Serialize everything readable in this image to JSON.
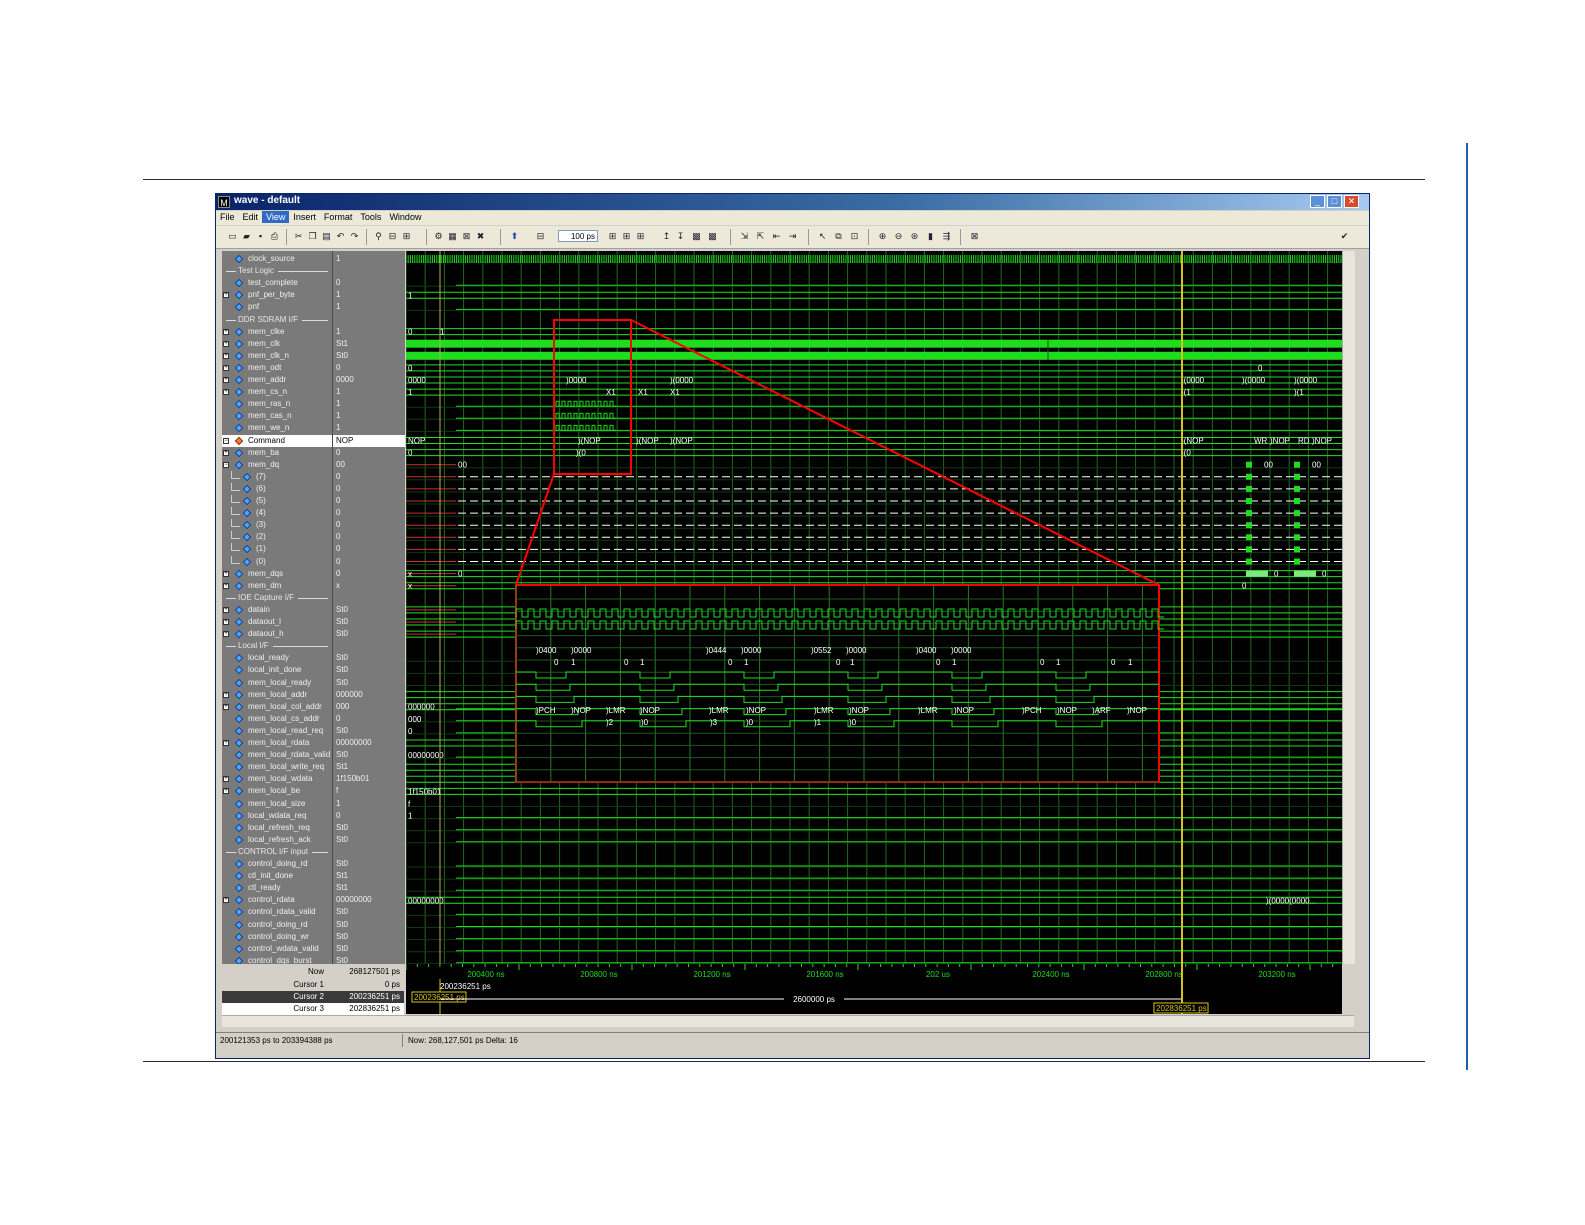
{
  "window": {
    "title": "wave - default",
    "menus": [
      "File",
      "Edit",
      "View",
      "Insert",
      "Format",
      "Tools",
      "Window"
    ],
    "active_menu": "View",
    "zoom_field": "100 ps"
  },
  "signals": [
    {
      "name": "clock_source",
      "value": "1",
      "type": "sig"
    },
    {
      "name": "Test Logic",
      "type": "divider"
    },
    {
      "name": "test_complete",
      "value": "0",
      "type": "sig"
    },
    {
      "name": "pnf_per_byte",
      "value": "1",
      "type": "bus"
    },
    {
      "name": "pnf",
      "value": "1",
      "type": "sig"
    },
    {
      "name": "DDR SDRAM I/F",
      "type": "divider"
    },
    {
      "name": "mem_clke",
      "value": "1",
      "type": "bus"
    },
    {
      "name": "mem_clk",
      "value": "St1",
      "type": "bus"
    },
    {
      "name": "mem_clk_n",
      "value": "St0",
      "type": "bus"
    },
    {
      "name": "mem_odt",
      "value": "0",
      "type": "bus"
    },
    {
      "name": "mem_addr",
      "value": "0000",
      "type": "bus"
    },
    {
      "name": "mem_cs_n",
      "value": "1",
      "type": "bus"
    },
    {
      "name": "mem_ras_n",
      "value": "1",
      "type": "sig"
    },
    {
      "name": "mem_cas_n",
      "value": "1",
      "type": "sig"
    },
    {
      "name": "mem_we_n",
      "value": "1",
      "type": "sig"
    },
    {
      "name": "Command",
      "value": "NOP",
      "type": "cmd"
    },
    {
      "name": "mem_ba",
      "value": "0",
      "type": "bus"
    },
    {
      "name": "mem_dq",
      "value": "00",
      "type": "busopen"
    },
    {
      "name": "(7)",
      "value": "0",
      "type": "child"
    },
    {
      "name": "(6)",
      "value": "0",
      "type": "child"
    },
    {
      "name": "(5)",
      "value": "0",
      "type": "child"
    },
    {
      "name": "(4)",
      "value": "0",
      "type": "child"
    },
    {
      "name": "(3)",
      "value": "0",
      "type": "child"
    },
    {
      "name": "(2)",
      "value": "0",
      "type": "child"
    },
    {
      "name": "(1)",
      "value": "0",
      "type": "child"
    },
    {
      "name": "(0)",
      "value": "0",
      "type": "child"
    },
    {
      "name": "mem_dqs",
      "value": "0",
      "type": "bus"
    },
    {
      "name": "mem_dm",
      "value": "x",
      "type": "bus"
    },
    {
      "name": "IOE Capture I/F",
      "type": "divider"
    },
    {
      "name": "datain",
      "value": "St0",
      "type": "bus"
    },
    {
      "name": "dataout_l",
      "value": "St0",
      "type": "bus"
    },
    {
      "name": "dataout_h",
      "value": "St0",
      "type": "bus"
    },
    {
      "name": "Local I/F",
      "type": "divider"
    },
    {
      "name": "local_ready",
      "value": "St0",
      "type": "sig"
    },
    {
      "name": "local_init_done",
      "value": "St0",
      "type": "sig"
    },
    {
      "name": "mem_local_ready",
      "value": "St0",
      "type": "sig"
    },
    {
      "name": "mem_local_addr",
      "value": "000000",
      "type": "bus"
    },
    {
      "name": "mem_local_col_addr",
      "value": "000",
      "type": "bus"
    },
    {
      "name": "mem_local_cs_addr",
      "value": "0",
      "type": "sig"
    },
    {
      "name": "mem_local_read_req",
      "value": "St0",
      "type": "sig"
    },
    {
      "name": "mem_local_rdata",
      "value": "00000000",
      "type": "bus"
    },
    {
      "name": "mem_local_rdata_valid",
      "value": "St0",
      "type": "sig"
    },
    {
      "name": "mem_local_write_req",
      "value": "St1",
      "type": "sig"
    },
    {
      "name": "mem_local_wdata",
      "value": "1f150b01",
      "type": "bus"
    },
    {
      "name": "mem_local_be",
      "value": "f",
      "type": "bus"
    },
    {
      "name": "mem_local_size",
      "value": "1",
      "type": "sig"
    },
    {
      "name": "local_wdata_req",
      "value": "0",
      "type": "sig"
    },
    {
      "name": "local_refresh_req",
      "value": "St0",
      "type": "sig"
    },
    {
      "name": "local_refresh_ack",
      "value": "St0",
      "type": "sig"
    },
    {
      "name": "CONTROL I/F input",
      "type": "divider"
    },
    {
      "name": "control_doing_rd",
      "value": "St0",
      "type": "sig"
    },
    {
      "name": "ctl_init_done",
      "value": "St1",
      "type": "sig"
    },
    {
      "name": "ctl_ready",
      "value": "St1",
      "type": "sig"
    },
    {
      "name": "control_rdata",
      "value": "00000000",
      "type": "bus"
    },
    {
      "name": "control_rdata_valid",
      "value": "St0",
      "type": "sig"
    },
    {
      "name": "control_doing_rd",
      "value": "St0",
      "type": "sig"
    },
    {
      "name": "control_doing_wr",
      "value": "St0",
      "type": "sig"
    },
    {
      "name": "control_wdata_valid",
      "value": "St0",
      "type": "sig"
    },
    {
      "name": "control_dqs_burst",
      "value": "St0",
      "type": "sig"
    }
  ],
  "wave_labels": {
    "pnf_per_byte": "1",
    "mem_clke": "0",
    "mem_clke_b": "1",
    "mem_odt": "0",
    "mem_addr_left": "0000",
    "mem_addr_mid": ")0000",
    "mem_addr_mid2": ")(0000",
    "mem_addr_burst": ")(0000",
    "mem_addr_right1": ")(0000",
    "mem_addr_right2": ")(0000",
    "mem_cs_left": "1",
    "mem_cs_x1": "X1",
    "mem_cs_x1b": "X1",
    "mem_cs_x1c": "X1",
    "mem_cs_r1": ")(1",
    "mem_cs_r2": ")(1",
    "mem_ba_left": "0",
    "mem_ba_mid": ")(0",
    "mem_ba_right": ")(0",
    "command_left": "NOP",
    "command_mid1": ")(NOP",
    "command_mid2": ")(NOP",
    "command_mid3": ")(NOP",
    "command_r1": ")(NOP",
    "command_r2": "WR",
    "command_r3": ")NOP",
    "command_r4": "RD",
    "command_r5": ")NOP",
    "mem_dq_left": "00",
    "mem_dq_r1": "00",
    "mem_dq_r2": "00",
    "mem_dqs_left": "x",
    "mem_dqs_0": "0",
    "mem_dqs_r1": "0",
    "mem_dqs_r2": "0",
    "mem_dm_left": "x",
    "mem_dm_r": "0",
    "mem_local_addr": "000000",
    "mem_local_col_addr": "000",
    "mem_local_cs_addr": "0",
    "mem_local_rdata": "00000000",
    "mem_local_wdata": "1f150b01",
    "mem_local_be": "f",
    "mem_local_size": "1",
    "control_rdata": "00000000",
    "control_rdata_r": ")(0000(0000...",
    "mem_odt_r": "0"
  },
  "zoom_inset": {
    "addr_labels": [
      ")0400",
      ")0000",
      ")0444",
      ")0000",
      ")0552",
      ")0000",
      ")0400",
      ")0000"
    ],
    "ba_labels": [
      "0",
      "1",
      "0",
      "1",
      "0",
      "1",
      "0",
      "1",
      "0",
      "1",
      "0",
      "1",
      "0",
      "1"
    ],
    "cmd_labels": [
      ")PCH",
      ")NOP",
      ")LMR",
      ")NOP",
      ")LMR",
      ")NOP",
      ")LMR",
      ")NOP",
      ")LMR",
      ")NOP",
      ")PCH",
      ")NOP",
      ")ARF",
      ")NOP"
    ],
    "ba2_labels": [
      ")2",
      ")0",
      ")3",
      ")0",
      ")1",
      ")0"
    ]
  },
  "timeline": {
    "ticks": [
      "200400 ns",
      "200800 ns",
      "201200 ns",
      "201600 ns",
      "202 us",
      "202400 ns",
      "202800 ns",
      "203200 ns"
    ],
    "cursor1_label": "200236251 ps",
    "cursor1_box": "200236251 ps",
    "delta_label": "2600000 ps",
    "cursor3_box": "202836251 ps"
  },
  "cursors": [
    {
      "label": "Now",
      "value": "268127501 ps"
    },
    {
      "label": "Cursor 1",
      "value": "0 ps"
    },
    {
      "label": "Cursor 2",
      "value": "200236251 ps"
    },
    {
      "label": "Cursor 3",
      "value": "202836251 ps"
    }
  ],
  "status": {
    "range": "200121353 ps to 203394388 ps",
    "now": "Now: 268,127,501 ps   Delta: 16"
  },
  "colors": {
    "wave": "#1fdc1f",
    "grid": "#1e6b1e",
    "cursor": "#d8c418",
    "zoom_box": "#ff0000",
    "bg": "#000000"
  }
}
